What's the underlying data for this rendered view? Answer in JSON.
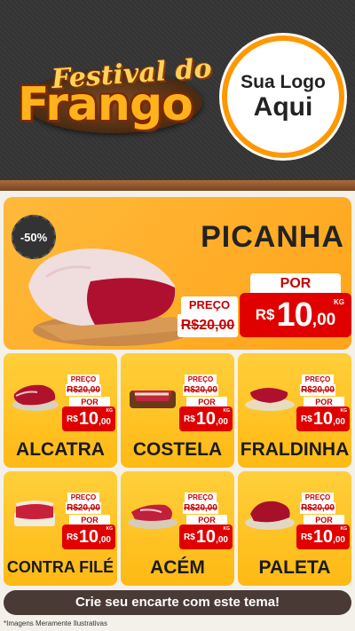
{
  "header": {
    "title_small": "Festival do",
    "title_big": "Frango",
    "logo_line1": "Sua Logo",
    "logo_line2": "Aqui"
  },
  "featured": {
    "badge": "-50%",
    "name": "PICANHA",
    "preco_label": "PREÇO",
    "old_price": "R$20,00",
    "por_label": "POR",
    "currency": "R$",
    "price_int": "10",
    "price_dec": ",00",
    "unit": "KG"
  },
  "products": [
    {
      "name": "ALCATRA",
      "preco_label": "PREÇO",
      "old_price": "R$20,00",
      "por_label": "POR",
      "currency": "R$",
      "price_int": "10",
      "price_dec": ",00",
      "unit": "KG"
    },
    {
      "name": "COSTELA",
      "preco_label": "PREÇO",
      "old_price": "R$20,00",
      "por_label": "POR",
      "currency": "R$",
      "price_int": "10",
      "price_dec": ",00",
      "unit": "KG"
    },
    {
      "name": "FRALDINHA",
      "preco_label": "PREÇO",
      "old_price": "R$20,00",
      "por_label": "POR",
      "currency": "R$",
      "price_int": "10",
      "price_dec": ",00",
      "unit": "KG"
    },
    {
      "name": "CONTRA FILÉ",
      "preco_label": "PREÇO",
      "old_price": "R$20,00",
      "por_label": "POR",
      "currency": "R$",
      "price_int": "10",
      "price_dec": ",00",
      "unit": "KG"
    },
    {
      "name": "ACÉM",
      "preco_label": "PREÇO",
      "old_price": "R$20,00",
      "por_label": "POR",
      "currency": "R$",
      "price_int": "10",
      "price_dec": ",00",
      "unit": "KG"
    },
    {
      "name": "PALETA",
      "preco_label": "PREÇO",
      "old_price": "R$20,00",
      "por_label": "POR",
      "currency": "R$",
      "price_int": "10",
      "price_dec": ",00",
      "unit": "KG"
    }
  ],
  "footer": {
    "cta": "Crie seu encarte com este tema!",
    "disclaimer": "*Imagens Meramente Ilustrativas"
  },
  "colors": {
    "accent": "#ffb21a",
    "price_red": "#e00000",
    "card_yellow": "#ffc62a",
    "header_dark": "#353535"
  }
}
